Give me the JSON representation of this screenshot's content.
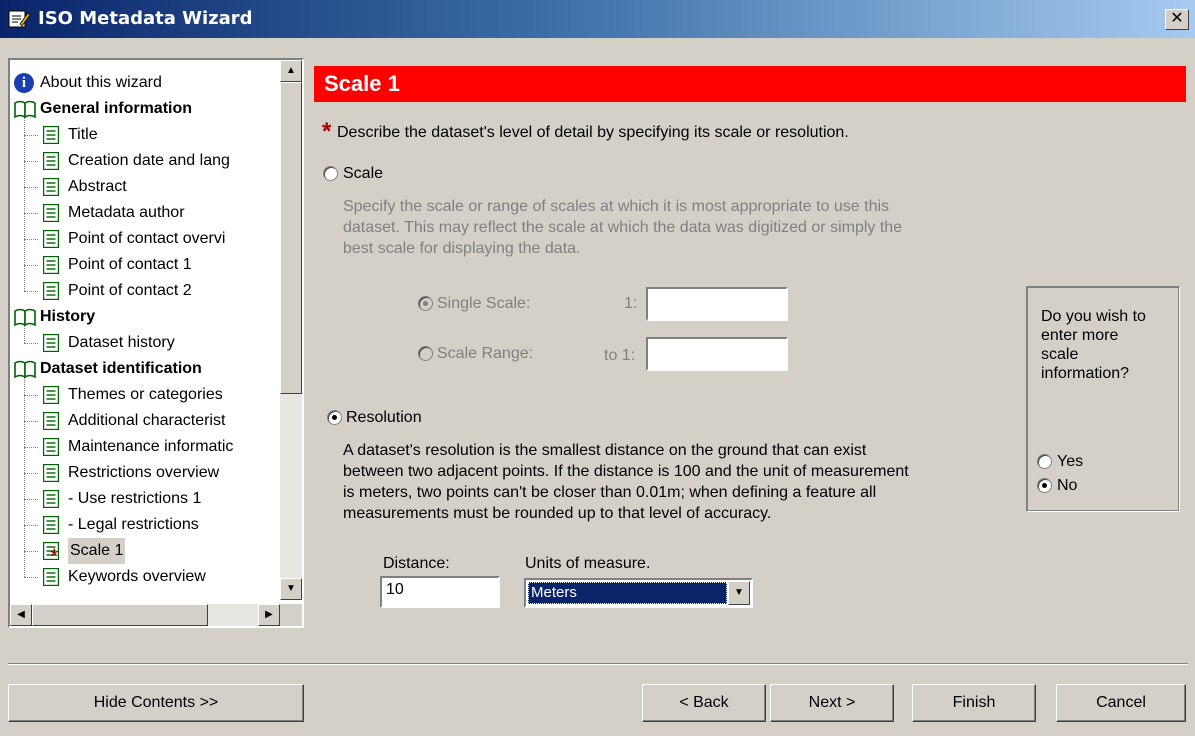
{
  "window": {
    "title": "ISO Metadata Wizard",
    "close_glyph": "✕"
  },
  "tree": {
    "items": [
      {
        "label": "About this wizard",
        "kind": "info",
        "level": 0
      },
      {
        "label": "General information",
        "kind": "book",
        "level": 0
      },
      {
        "label": "Title",
        "kind": "doc",
        "level": 1
      },
      {
        "label": "Creation date and lang",
        "kind": "doc",
        "level": 1
      },
      {
        "label": "Abstract",
        "kind": "doc",
        "level": 1
      },
      {
        "label": "Metadata author",
        "kind": "doc",
        "level": 1
      },
      {
        "label": "Point of contact overvi",
        "kind": "doc",
        "level": 1
      },
      {
        "label": "Point of contact 1",
        "kind": "doc",
        "level": 1
      },
      {
        "label": "Point of contact 2",
        "kind": "doc",
        "level": 1
      },
      {
        "label": "History",
        "kind": "book",
        "level": 0
      },
      {
        "label": "Dataset history",
        "kind": "doc",
        "level": 1
      },
      {
        "label": "Dataset identification",
        "kind": "book",
        "level": 0
      },
      {
        "label": "Themes or categories",
        "kind": "doc",
        "level": 1
      },
      {
        "label": "Additional characterist",
        "kind": "doc",
        "level": 1
      },
      {
        "label": "Maintenance informatic",
        "kind": "doc",
        "level": 1
      },
      {
        "label": "Restrictions overview",
        "kind": "doc",
        "level": 1
      },
      {
        "label": "- Use restrictions 1",
        "kind": "doc",
        "level": 1
      },
      {
        "label": "- Legal restrictions",
        "kind": "doc",
        "level": 1
      },
      {
        "label": "Scale 1",
        "kind": "doc-required",
        "level": 1,
        "selected": true
      },
      {
        "label": "Keywords overview",
        "kind": "doc",
        "level": 1
      }
    ]
  },
  "page": {
    "header": "Scale 1",
    "required_mark": "*",
    "instruction": "Describe the dataset's level of detail by specifying its scale or resolution.",
    "scale_option": {
      "label": "Scale",
      "selected": false,
      "description_lines": [
        "Specify the scale or range of scales at which it is most appropriate to use this",
        "dataset. This may reflect the scale at which the data was digitized or simply the",
        "best scale for displaying the data."
      ],
      "single_scale_label": "Single Scale:",
      "single_scale_prefix": "1:",
      "single_scale_value": "",
      "scale_range_label": "Scale Range:",
      "scale_range_prefix": "to 1:",
      "scale_range_value": ""
    },
    "resolution_option": {
      "label": "Resolution",
      "selected": true,
      "description_lines": [
        "A dataset's resolution is the smallest distance on the ground that can exist",
        "between two adjacent points. If the distance is 100 and the unit of measurement",
        "is meters, two points can't be closer than 0.01m; when defining a feature all",
        "measurements must be rounded up to that level of accuracy."
      ],
      "distance_label": "Distance:",
      "distance_value": "10",
      "units_label": "Units of measure.",
      "units_value": "Meters"
    },
    "more_info": {
      "question_lines": [
        "Do you wish to",
        "enter more",
        "scale",
        "information?"
      ],
      "yes_label": "Yes",
      "no_label": "No",
      "selected": "No"
    }
  },
  "buttons": {
    "hide_contents": "Hide Contents >>",
    "back": "< Back",
    "next": "Next >",
    "finish": "Finish",
    "cancel": "Cancel"
  },
  "colors": {
    "header_bg": "#ff0000",
    "title_bar": "#0a246a",
    "required_star": "#a00000"
  }
}
